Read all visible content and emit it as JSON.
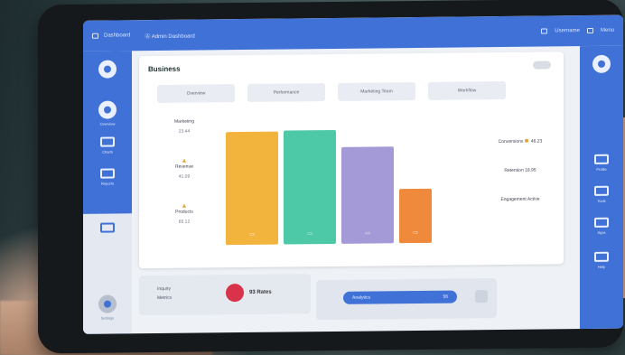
{
  "topbar": {
    "app_name": "Dashboard",
    "nav": "Ⓐ Admin Dashboard",
    "user": "Username",
    "menu": "Menu"
  },
  "left_sidebar": {
    "items": [
      "Overview",
      "Charts",
      "Reports",
      "Settings"
    ]
  },
  "right_sidebar": {
    "items": [
      "Profile",
      "Tools",
      "Apps",
      "Help"
    ]
  },
  "main": {
    "title": "Business",
    "tabs": [
      "Overview",
      "Performance",
      "Marketing Team",
      "Workflow"
    ],
    "left_stats": [
      {
        "label": "Marketing",
        "value": "23.44"
      },
      {
        "label": "Revenue",
        "value": "41.09"
      },
      {
        "label": "Products",
        "value": "65.12"
      }
    ],
    "right_stats": [
      {
        "label": "Conversions",
        "value": "46.23"
      },
      {
        "label": "Retention",
        "value": "18.95"
      },
      {
        "label": "Engagement",
        "value": "Active"
      }
    ]
  },
  "chart_data": {
    "type": "bar",
    "categories": [
      "",
      "",
      "",
      ""
    ],
    "values": [
      96,
      97,
      82,
      46
    ],
    "colors": [
      "#f2b43d",
      "#4ec9a8",
      "#a59ad8",
      "#ef8a3c"
    ],
    "ylim": [
      0,
      100
    ]
  },
  "footer": {
    "left_label": "Inquiry",
    "left_sub": "Metrics",
    "alert_text": "93 Rates",
    "pill_text": "Analytics",
    "pill_tail": "56"
  },
  "colors": {
    "accent": "#3f71d6",
    "alert": "#d8334b"
  }
}
